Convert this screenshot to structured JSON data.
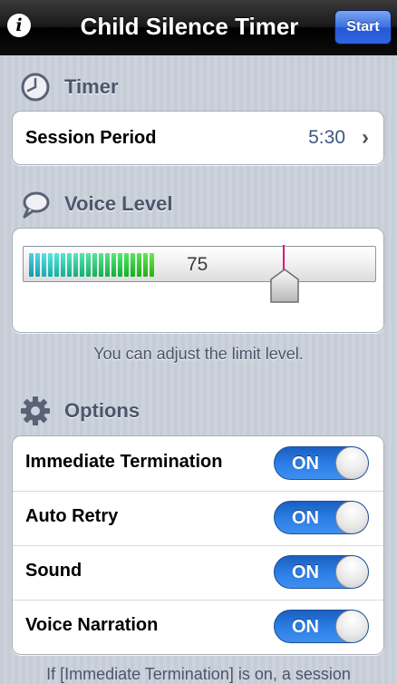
{
  "nav": {
    "title": "Child Silence Timer",
    "info_icon": "info-icon",
    "start_label": "Start"
  },
  "timer_section": {
    "header": "Timer",
    "icon": "clock-icon",
    "session_period_label": "Session Period",
    "session_period_value": "5:30"
  },
  "voice_section": {
    "header": "Voice Level",
    "icon": "speech-bubble-icon",
    "meter_value": "75",
    "meter_fraction": 0.75,
    "hint": "You can adjust the limit level.",
    "colors": {
      "limit_line": "#e0147c"
    }
  },
  "options_section": {
    "header": "Options",
    "icon": "gear-icon",
    "items": [
      {
        "label": "Immediate Termination",
        "state": "ON"
      },
      {
        "label": "Auto Retry",
        "state": "ON"
      },
      {
        "label": "Sound",
        "state": "ON"
      },
      {
        "label": "Voice Narration",
        "state": "ON"
      }
    ]
  },
  "footer": {
    "text": "If [Immediate Termination] is on, a session"
  },
  "colors": {
    "toggle_on": "#2d7fe6",
    "header_text": "#4c566a",
    "value_text": "#3d5785"
  }
}
